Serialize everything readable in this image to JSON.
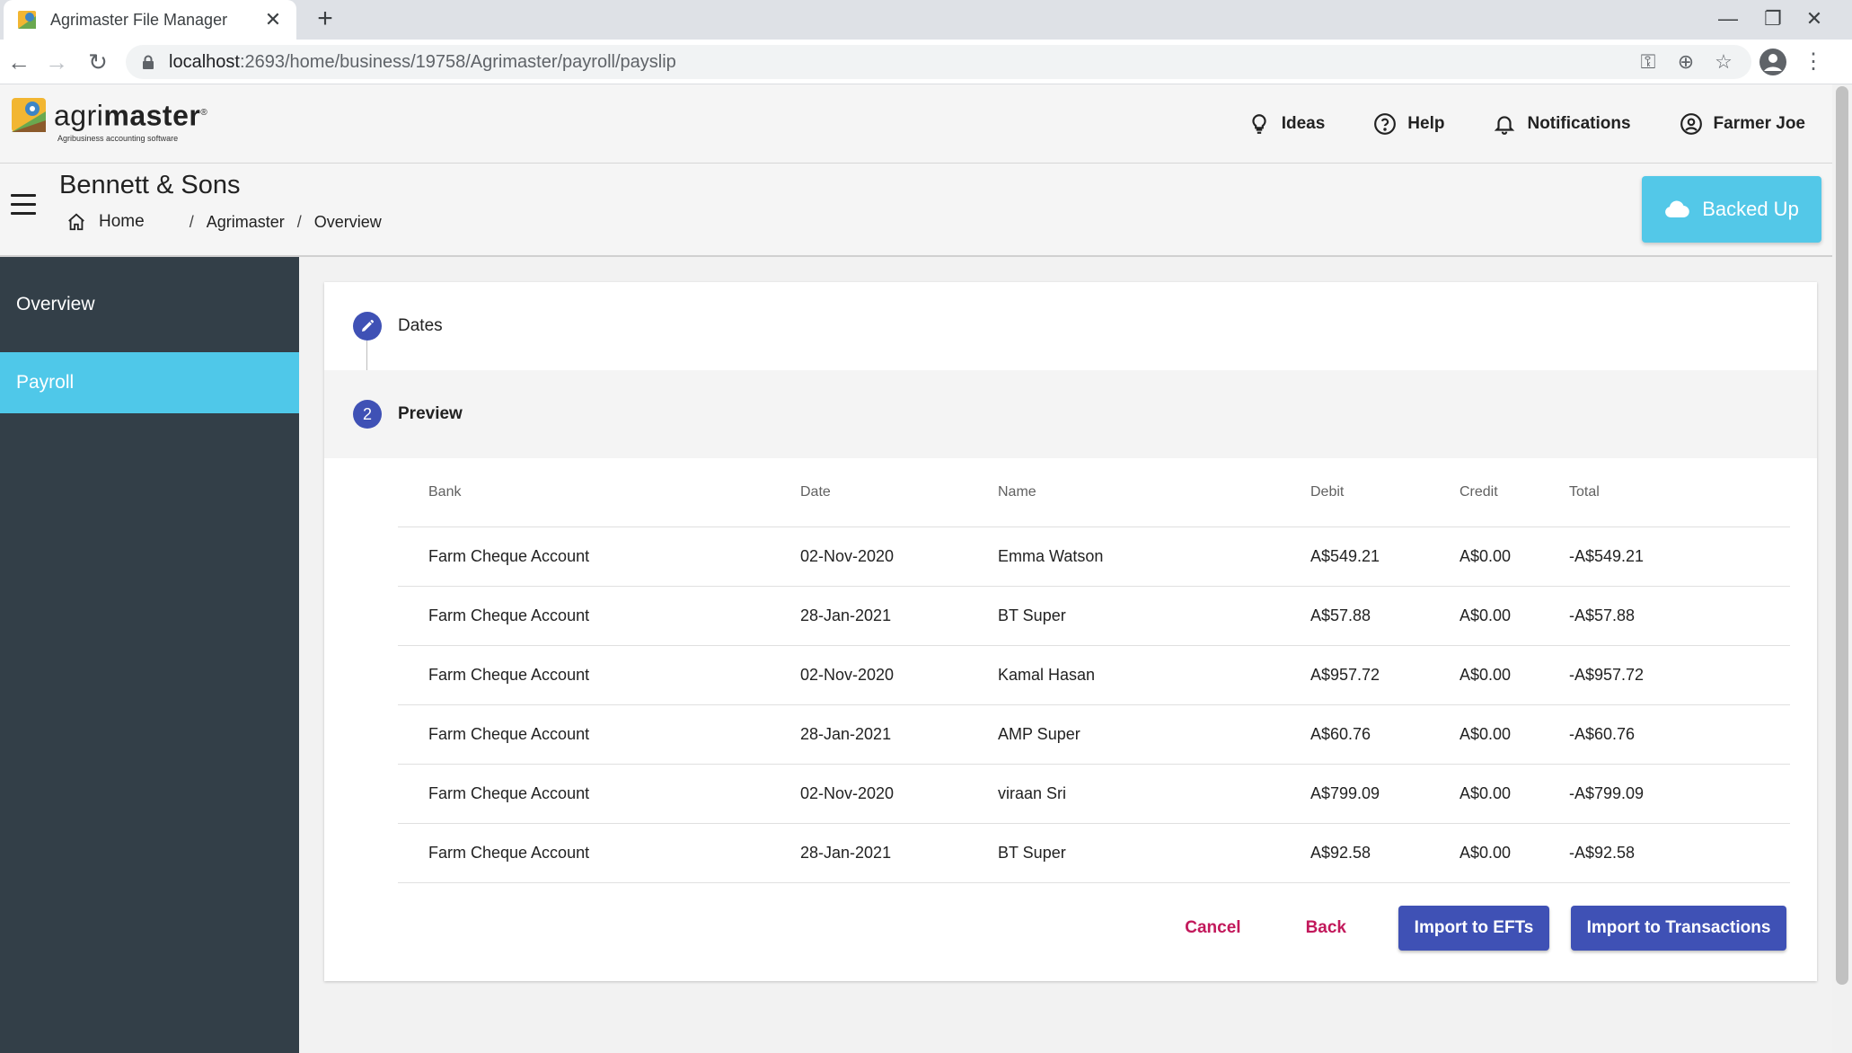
{
  "browser": {
    "tab_title": "Agrimaster File Manager",
    "url_host": "localhost",
    "url_path": ":2693/home/business/19758/Agrimaster/payroll/payslip"
  },
  "header": {
    "logo_text_a": "agri",
    "logo_text_b": "master",
    "logo_reg": "®",
    "logo_tagline": "Agribusiness accounting software",
    "nav": {
      "ideas": "Ideas",
      "help": "Help",
      "notifications": "Notifications",
      "user": "Farmer Joe"
    }
  },
  "titlebar": {
    "company": "Bennett & Sons",
    "breadcrumb": {
      "home": "Home",
      "sep": "/",
      "crumb1": "Agrimaster",
      "crumb2": "Overview"
    },
    "backup_label": "Backed Up"
  },
  "sidebar": {
    "items": [
      {
        "label": "Overview"
      },
      {
        "label": "Payroll"
      }
    ]
  },
  "stepper": {
    "step1_label": "Dates",
    "step2_number": "2",
    "step2_label": "Preview"
  },
  "table": {
    "headers": {
      "bank": "Bank",
      "date": "Date",
      "name": "Name",
      "debit": "Debit",
      "credit": "Credit",
      "total": "Total"
    },
    "rows": [
      {
        "bank": "Farm Cheque Account",
        "date": "02-Nov-2020",
        "name": "Emma Watson",
        "debit": "A$549.21",
        "credit": "A$0.00",
        "total": "-A$549.21"
      },
      {
        "bank": "Farm Cheque Account",
        "date": "28-Jan-2021",
        "name": "BT Super",
        "debit": "A$57.88",
        "credit": "A$0.00",
        "total": "-A$57.88"
      },
      {
        "bank": "Farm Cheque Account",
        "date": "02-Nov-2020",
        "name": "Kamal Hasan",
        "debit": "A$957.72",
        "credit": "A$0.00",
        "total": "-A$957.72"
      },
      {
        "bank": "Farm Cheque Account",
        "date": "28-Jan-2021",
        "name": "AMP Super",
        "debit": "A$60.76",
        "credit": "A$0.00",
        "total": "-A$60.76"
      },
      {
        "bank": "Farm Cheque Account",
        "date": "02-Nov-2020",
        "name": "viraan Sri",
        "debit": "A$799.09",
        "credit": "A$0.00",
        "total": "-A$799.09"
      },
      {
        "bank": "Farm Cheque Account",
        "date": "28-Jan-2021",
        "name": "BT Super",
        "debit": "A$92.58",
        "credit": "A$0.00",
        "total": "-A$92.58"
      }
    ]
  },
  "actions": {
    "cancel": "Cancel",
    "back": "Back",
    "import_efts": "Import to EFTs",
    "import_transactions": "Import to Transactions"
  },
  "colors": {
    "primary": "#3f51b5",
    "accent_text": "#c2185b",
    "sidebar_bg": "#333f48",
    "sidebar_active": "#4fc8e9",
    "backup_button": "#53c8e8"
  }
}
